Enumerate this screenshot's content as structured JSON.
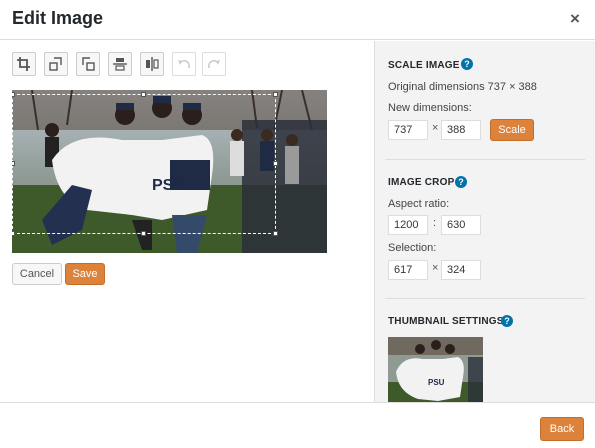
{
  "modal": {
    "title": "Edit Image",
    "close_glyph": "×"
  },
  "toolbar": {
    "buttons": [
      {
        "name": "crop-icon"
      },
      {
        "name": "rotate-left-icon"
      },
      {
        "name": "rotate-right-icon"
      },
      {
        "name": "flip-vertical-icon"
      },
      {
        "name": "flip-horizontal-icon"
      },
      {
        "name": "undo-icon",
        "disabled": true
      },
      {
        "name": "redo-icon",
        "disabled": true
      }
    ]
  },
  "editor": {
    "cancel_label": "Cancel",
    "save_label": "Save"
  },
  "scale_image": {
    "title": "SCALE IMAGE",
    "original_label": "Original dimensions 737 × 388",
    "new_dimensions_label": "New dimensions:",
    "width": "737",
    "height": "388",
    "separator": "×",
    "scale_label": "Scale"
  },
  "image_crop": {
    "title": "IMAGE CROP",
    "aspect_label": "Aspect ratio:",
    "aspect_w": "1200",
    "aspect_h": "630",
    "aspect_separator": ":",
    "selection_label": "Selection:",
    "sel_w": "617",
    "sel_h": "324",
    "selection_separator": "×"
  },
  "thumbnail": {
    "title": "THUMBNAIL SETTINGS"
  },
  "footer": {
    "back_label": "Back"
  },
  "colors": {
    "accent": "#dd823b",
    "help": "#0073aa",
    "sidebar_bg": "#f3f3f3"
  }
}
